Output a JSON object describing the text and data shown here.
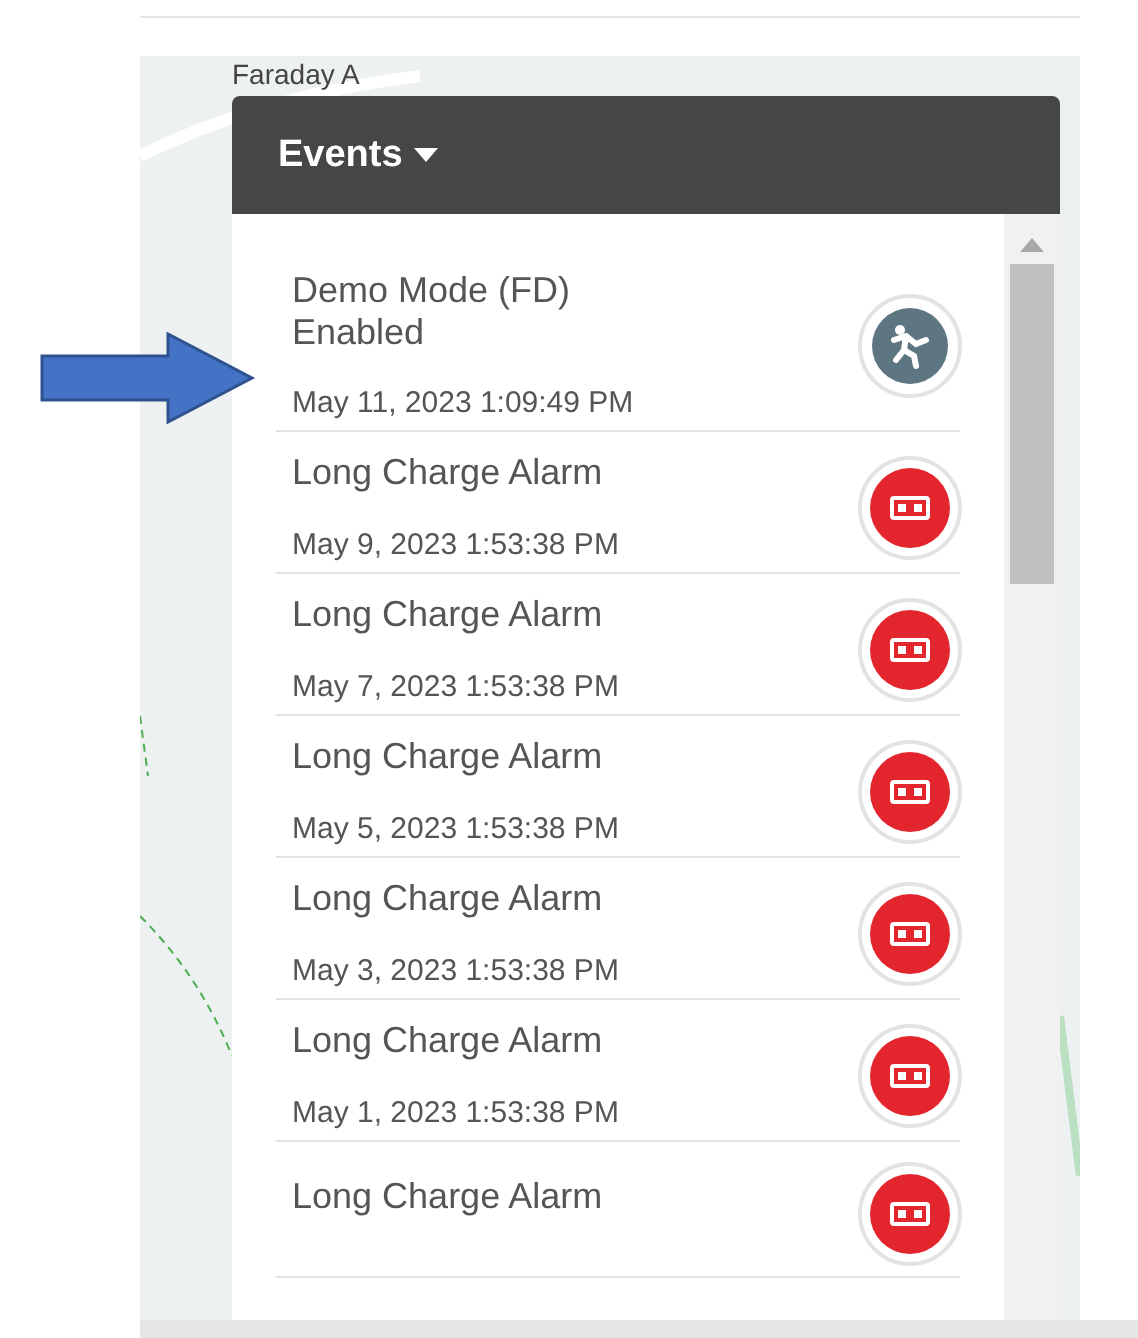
{
  "map": {
    "street_label": "Faraday A"
  },
  "panel": {
    "title": "Events"
  },
  "events": [
    {
      "title": "Demo Mode (FD) Enabled",
      "time": "May 11, 2023 1:09:49 PM",
      "kind": "demo"
    },
    {
      "title": "Long Charge Alarm",
      "time": "May 9, 2023 1:53:38 PM",
      "kind": "alarm"
    },
    {
      "title": "Long Charge Alarm",
      "time": "May 7, 2023 1:53:38 PM",
      "kind": "alarm"
    },
    {
      "title": "Long Charge Alarm",
      "time": "May 5, 2023 1:53:38 PM",
      "kind": "alarm"
    },
    {
      "title": "Long Charge Alarm",
      "time": "May 3, 2023 1:53:38 PM",
      "kind": "alarm"
    },
    {
      "title": "Long Charge Alarm",
      "time": "May 1, 2023 1:53:38 PM",
      "kind": "alarm"
    },
    {
      "title": "Long Charge Alarm",
      "kind": "alarm"
    }
  ]
}
